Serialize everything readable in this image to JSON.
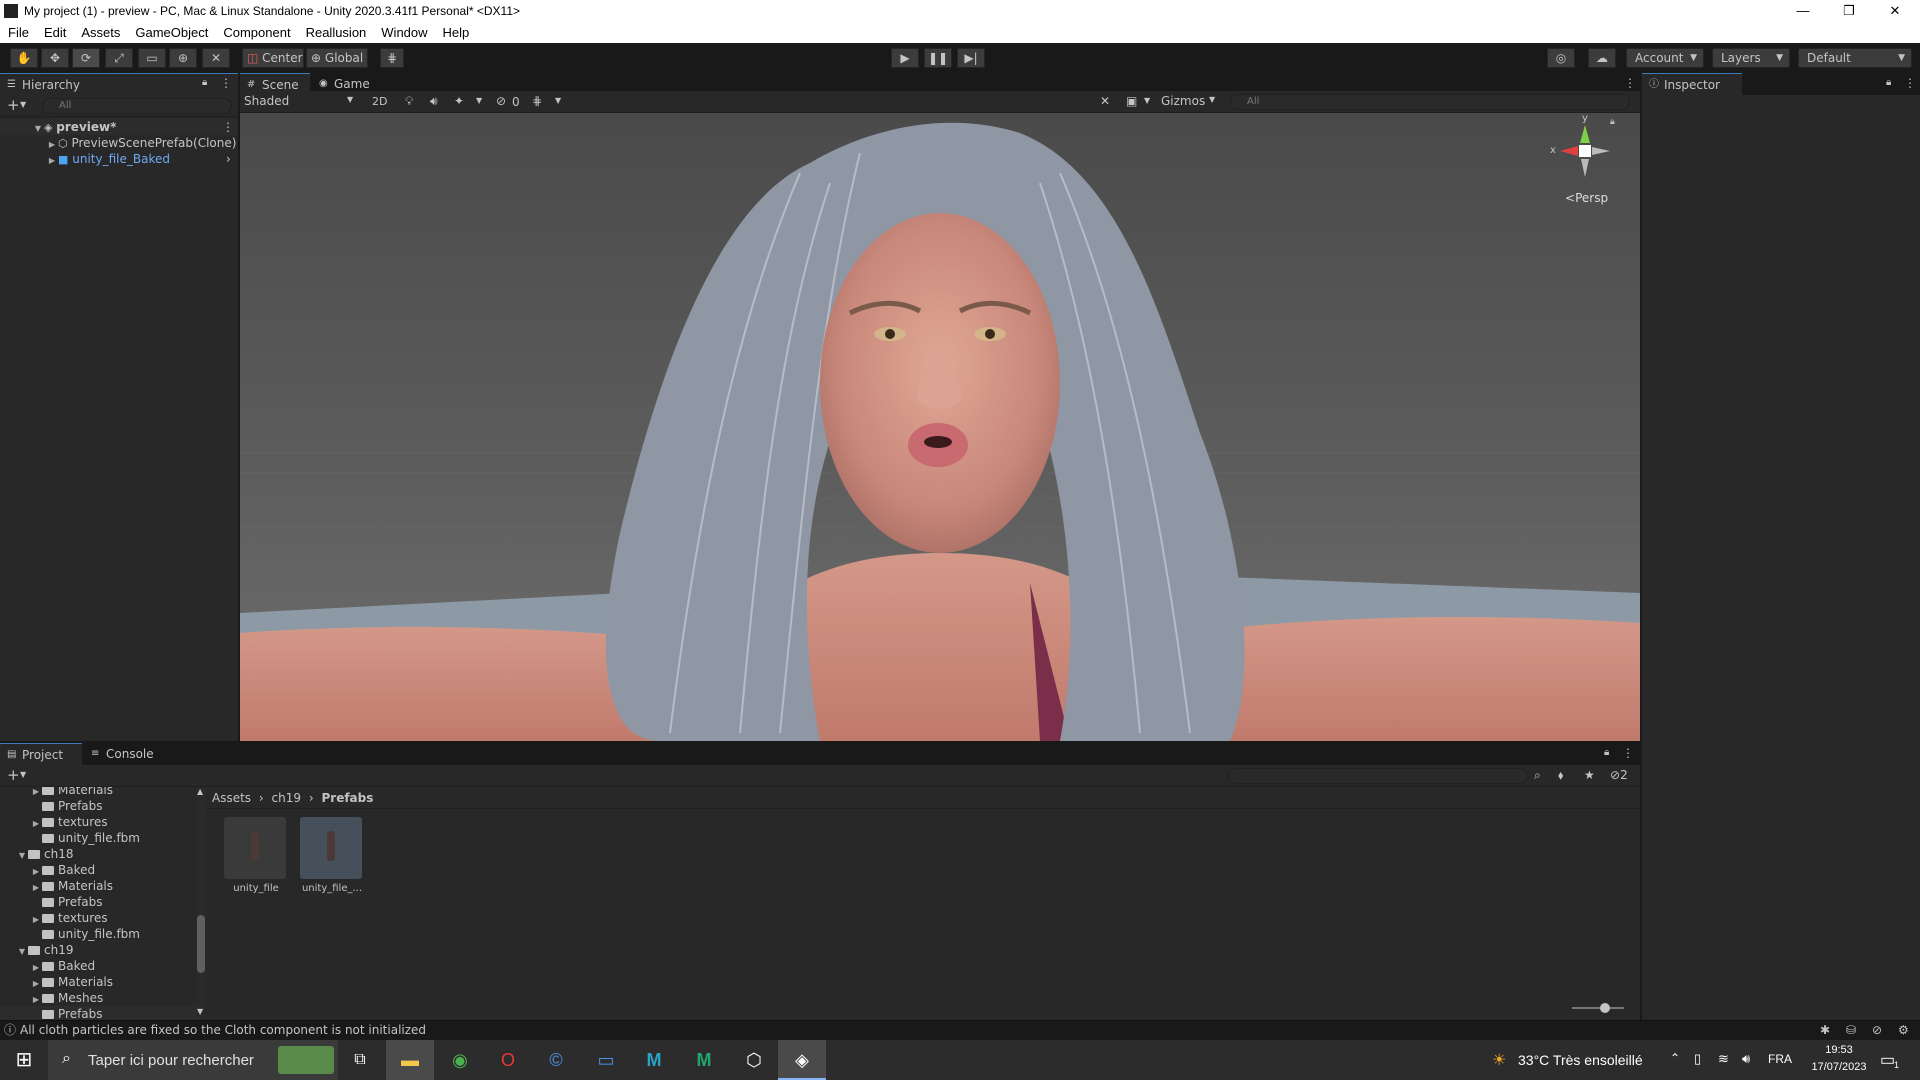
{
  "titlebar": {
    "title": "My project (1) - preview - PC, Mac & Linux Standalone - Unity 2020.3.41f1 Personal* <DX11>",
    "minimize": "—",
    "maximize": "❐",
    "close": "✕"
  },
  "menu": [
    "File",
    "Edit",
    "Assets",
    "GameObject",
    "Component",
    "Reallusion",
    "Window",
    "Help"
  ],
  "toolbar": {
    "pivot_label": "Center",
    "space_label": "Global",
    "account_label": "Account",
    "layers_label": "Layers",
    "layout_label": "Default"
  },
  "hierarchy": {
    "tab_label": "Hierarchy",
    "search_placeholder": "All",
    "scene_name": "preview*",
    "items": [
      "PreviewScenePrefab(Clone)",
      "unity_file_Baked"
    ]
  },
  "scene_view": {
    "tabs": [
      "Scene",
      "Game"
    ],
    "shading_mode": "Shaded",
    "mode_2d": "2D",
    "hidden_count": "0",
    "gizmos_label": "Gizmos",
    "search_placeholder": "All",
    "projection": "Persp",
    "axis_y": "y",
    "axis_x": "x"
  },
  "inspector": {
    "tab_label": "Inspector"
  },
  "project": {
    "tabs": [
      "Project",
      "Console"
    ],
    "hidden_count": "2",
    "tree": [
      {
        "label": "Materials",
        "depth": 2,
        "expandable": true
      },
      {
        "label": "Prefabs",
        "depth": 2,
        "expandable": false
      },
      {
        "label": "textures",
        "depth": 2,
        "expandable": true
      },
      {
        "label": "unity_file.fbm",
        "depth": 2,
        "expandable": false
      },
      {
        "label": "ch18",
        "depth": 1,
        "expandable": true,
        "open": true
      },
      {
        "label": "Baked",
        "depth": 2,
        "expandable": true
      },
      {
        "label": "Materials",
        "depth": 2,
        "expandable": true
      },
      {
        "label": "Prefabs",
        "depth": 2,
        "expandable": false
      },
      {
        "label": "textures",
        "depth": 2,
        "expandable": true
      },
      {
        "label": "unity_file.fbm",
        "depth": 2,
        "expandable": false
      },
      {
        "label": "ch19",
        "depth": 1,
        "expandable": true,
        "open": true
      },
      {
        "label": "Baked",
        "depth": 2,
        "expandable": true
      },
      {
        "label": "Materials",
        "depth": 2,
        "expandable": true
      },
      {
        "label": "Meshes",
        "depth": 2,
        "expandable": true
      },
      {
        "label": "Prefabs",
        "depth": 2,
        "expandable": false,
        "selected": true
      }
    ],
    "breadcrumb": [
      "Assets",
      "ch19",
      "Prefabs"
    ],
    "assets": [
      "unity_file",
      "unity_file_..."
    ]
  },
  "status": {
    "message": "All cloth particles are fixed so the Cloth component is not initialized"
  },
  "taskbar": {
    "search_placeholder": "Taper ici pour rechercher",
    "weather": "33°C  Très ensoleillé",
    "language": "FRA",
    "time": "19:53",
    "date": "17/07/2023",
    "notification_count": "1"
  }
}
